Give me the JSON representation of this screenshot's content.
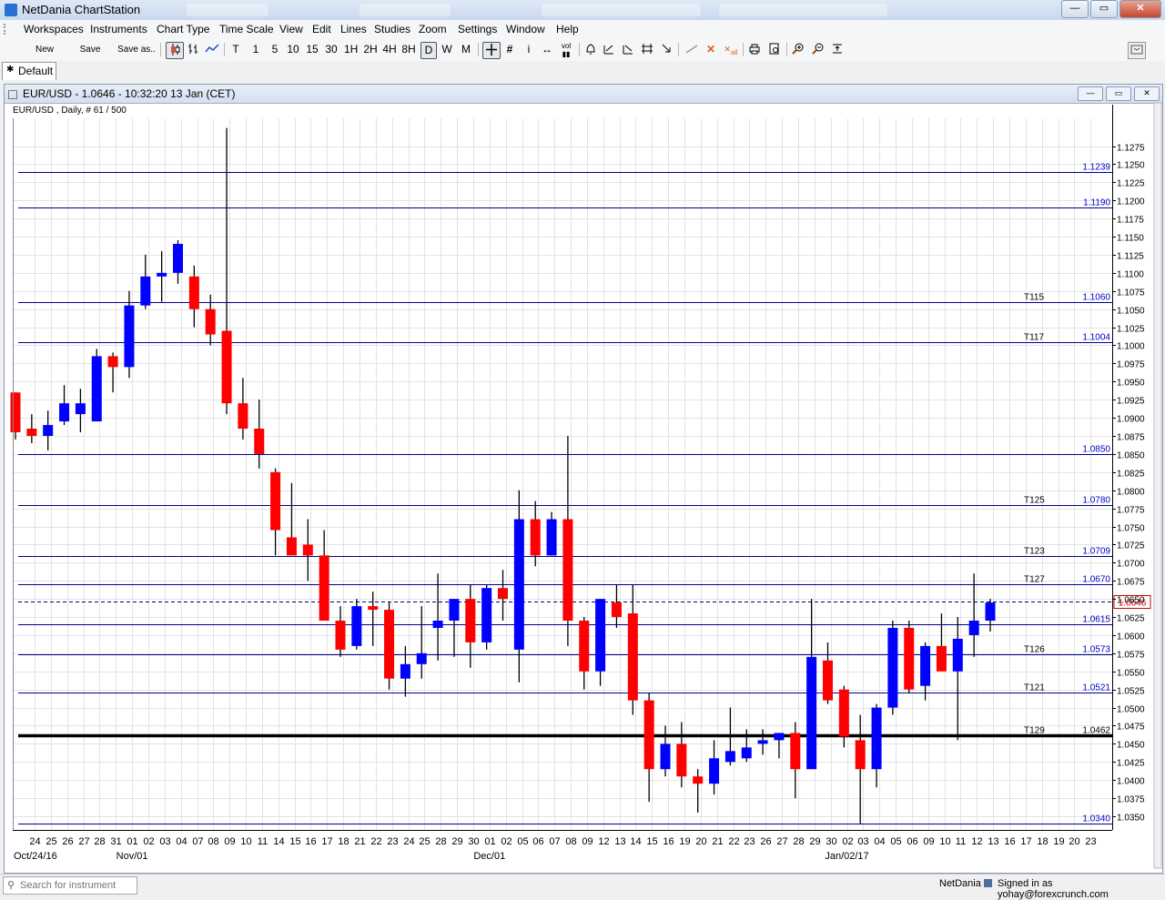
{
  "app": {
    "title": "NetDania ChartStation",
    "window_buttons": [
      "—",
      "▭",
      "✕"
    ]
  },
  "menu": [
    "Workspaces",
    "Instruments",
    "Chart Type",
    "Time Scale",
    "View",
    "Edit",
    "Lines",
    "Zoom",
    "Studies",
    "Zoom",
    "Settings",
    "Window",
    "Help"
  ],
  "toolbar": {
    "new": "New",
    "save": "Save",
    "save_as": "Save as..",
    "timescales": [
      "T",
      "1",
      "5",
      "10",
      "15",
      "30",
      "1H",
      "2H",
      "4H",
      "8H",
      "D",
      "W",
      "M"
    ],
    "active_timescale": "D",
    "icons": [
      "candle-icon",
      "bar-chart-icon",
      "line-chart-icon",
      "crosshair-icon",
      "grid-icon",
      "info-icon",
      "arrows-icon",
      "volume-icon",
      "alarm-icon",
      "trend-icons",
      "draw-line-icon",
      "delete-icon",
      "delete-all-icon",
      "print-icon",
      "preview-icon",
      "zoom-in-icon",
      "zoom-out-icon",
      "fit-icon"
    ]
  },
  "workspace_tab": "Default",
  "chart_window": {
    "title": "EUR/USD - 1.0646 - 10:32:20  13 Jan (CET)",
    "subtitle": "EUR/USD , Daily, # 61 / 500",
    "buttons": [
      "—",
      "▭",
      "✕"
    ]
  },
  "chart_data": {
    "type": "candlestick",
    "instrument": "EUR/USD",
    "ylim": [
      1.034,
      1.1275
    ],
    "y_ticks": [
      1.035,
      1.0375,
      1.04,
      1.0425,
      1.045,
      1.0475,
      1.05,
      1.0525,
      1.055,
      1.0575,
      1.06,
      1.0625,
      1.065,
      1.0675,
      1.07,
      1.0725,
      1.075,
      1.0775,
      1.08,
      1.0825,
      1.085,
      1.0875,
      1.09,
      1.0925,
      1.095,
      1.0975,
      1.1,
      1.1025,
      1.105,
      1.1075,
      1.11,
      1.1125,
      1.115,
      1.1175,
      1.12,
      1.1225,
      1.125,
      1.1275
    ],
    "x_labels": [
      "24",
      "25",
      "26",
      "27",
      "28",
      "31",
      "01",
      "02",
      "03",
      "04",
      "07",
      "08",
      "09",
      "10",
      "11",
      "14",
      "15",
      "16",
      "17",
      "18",
      "21",
      "22",
      "23",
      "24",
      "25",
      "28",
      "29",
      "30",
      "01",
      "02",
      "05",
      "06",
      "07",
      "08",
      "09",
      "12",
      "13",
      "14",
      "15",
      "16",
      "19",
      "20",
      "21",
      "22",
      "23",
      "26",
      "27",
      "28",
      "29",
      "30",
      "02",
      "03",
      "04",
      "05",
      "06",
      "09",
      "10",
      "11",
      "12",
      "13",
      "16",
      "17",
      "18",
      "19",
      "20",
      "23"
    ],
    "month_labels": [
      {
        "text": "Oct/24/16",
        "at_index": 0
      },
      {
        "text": "Nov/01",
        "at_index": 6
      },
      {
        "text": "Dec/01",
        "at_index": 28
      },
      {
        "text": "Jan/02/17",
        "at_index": 50
      }
    ],
    "candles": [
      {
        "o": 1.0935,
        "h": 1.0935,
        "l": 1.087,
        "c": 1.088
      },
      {
        "o": 1.0885,
        "h": 1.0905,
        "l": 1.0865,
        "c": 1.0875
      },
      {
        "o": 1.0875,
        "h": 1.091,
        "l": 1.0855,
        "c": 1.089
      },
      {
        "o": 1.0895,
        "h": 1.0945,
        "l": 1.089,
        "c": 1.092
      },
      {
        "o": 1.0905,
        "h": 1.094,
        "l": 1.088,
        "c": 1.092
      },
      {
        "o": 1.0895,
        "h": 1.0995,
        "l": 1.0895,
        "c": 1.0985
      },
      {
        "o": 1.0985,
        "h": 1.099,
        "l": 1.0935,
        "c": 1.097
      },
      {
        "o": 1.097,
        "h": 1.1075,
        "l": 1.0955,
        "c": 1.1055
      },
      {
        "o": 1.1055,
        "h": 1.1125,
        "l": 1.105,
        "c": 1.1095
      },
      {
        "o": 1.1095,
        "h": 1.113,
        "l": 1.106,
        "c": 1.11
      },
      {
        "o": 1.11,
        "h": 1.1145,
        "l": 1.1085,
        "c": 1.114
      },
      {
        "o": 1.1095,
        "h": 1.111,
        "l": 1.1025,
        "c": 1.105
      },
      {
        "o": 1.105,
        "h": 1.107,
        "l": 1.1,
        "c": 1.1015
      },
      {
        "o": 1.102,
        "h": 1.13,
        "l": 1.0905,
        "c": 1.092
      },
      {
        "o": 1.092,
        "h": 1.0955,
        "l": 1.087,
        "c": 1.0885
      },
      {
        "o": 1.0885,
        "h": 1.0925,
        "l": 1.083,
        "c": 1.085
      },
      {
        "o": 1.0825,
        "h": 1.083,
        "l": 1.071,
        "c": 1.0745
      },
      {
        "o": 1.0735,
        "h": 1.081,
        "l": 1.0715,
        "c": 1.071
      },
      {
        "o": 1.0725,
        "h": 1.076,
        "l": 1.0675,
        "c": 1.071
      },
      {
        "o": 1.071,
        "h": 1.0745,
        "l": 1.0635,
        "c": 1.062
      },
      {
        "o": 1.062,
        "h": 1.064,
        "l": 1.057,
        "c": 1.058
      },
      {
        "o": 1.0585,
        "h": 1.065,
        "l": 1.058,
        "c": 1.064
      },
      {
        "o": 1.064,
        "h": 1.066,
        "l": 1.0585,
        "c": 1.0635
      },
      {
        "o": 1.0635,
        "h": 1.0645,
        "l": 1.0525,
        "c": 1.054
      },
      {
        "o": 1.054,
        "h": 1.0585,
        "l": 1.0515,
        "c": 1.056
      },
      {
        "o": 1.056,
        "h": 1.064,
        "l": 1.054,
        "c": 1.0575
      },
      {
        "o": 1.061,
        "h": 1.0685,
        "l": 1.0565,
        "c": 1.062
      },
      {
        "o": 1.062,
        "h": 1.065,
        "l": 1.057,
        "c": 1.065
      },
      {
        "o": 1.065,
        "h": 1.067,
        "l": 1.0555,
        "c": 1.059
      },
      {
        "o": 1.059,
        "h": 1.067,
        "l": 1.058,
        "c": 1.0665
      },
      {
        "o": 1.0665,
        "h": 1.069,
        "l": 1.062,
        "c": 1.065
      },
      {
        "o": 1.058,
        "h": 1.08,
        "l": 1.0535,
        "c": 1.076
      },
      {
        "o": 1.076,
        "h": 1.0785,
        "l": 1.0695,
        "c": 1.071
      },
      {
        "o": 1.071,
        "h": 1.077,
        "l": 1.071,
        "c": 1.076
      },
      {
        "o": 1.076,
        "h": 1.0875,
        "l": 1.0585,
        "c": 1.062
      },
      {
        "o": 1.062,
        "h": 1.0625,
        "l": 1.0525,
        "c": 1.055
      },
      {
        "o": 1.055,
        "h": 1.065,
        "l": 1.053,
        "c": 1.065
      },
      {
        "o": 1.0645,
        "h": 1.067,
        "l": 1.061,
        "c": 1.0625
      },
      {
        "o": 1.063,
        "h": 1.067,
        "l": 1.049,
        "c": 1.051
      },
      {
        "o": 1.051,
        "h": 1.052,
        "l": 1.037,
        "c": 1.0415
      },
      {
        "o": 1.0415,
        "h": 1.0475,
        "l": 1.0405,
        "c": 1.045
      },
      {
        "o": 1.045,
        "h": 1.048,
        "l": 1.039,
        "c": 1.0405
      },
      {
        "o": 1.0405,
        "h": 1.0415,
        "l": 1.0355,
        "c": 1.0395
      },
      {
        "o": 1.0395,
        "h": 1.0455,
        "l": 1.038,
        "c": 1.043
      },
      {
        "o": 1.0425,
        "h": 1.05,
        "l": 1.042,
        "c": 1.044
      },
      {
        "o": 1.043,
        "h": 1.047,
        "l": 1.0425,
        "c": 1.0445
      },
      {
        "o": 1.045,
        "h": 1.047,
        "l": 1.0435,
        "c": 1.0455
      },
      {
        "o": 1.0455,
        "h": 1.0465,
        "l": 1.043,
        "c": 1.0465
      },
      {
        "o": 1.0465,
        "h": 1.048,
        "l": 1.0375,
        "c": 1.0415
      },
      {
        "o": 1.0415,
        "h": 1.065,
        "l": 1.0415,
        "c": 1.057
      },
      {
        "o": 1.0565,
        "h": 1.059,
        "l": 1.0505,
        "c": 1.051
      },
      {
        "o": 1.0525,
        "h": 1.053,
        "l": 1.0445,
        "c": 1.046
      },
      {
        "o": 1.0455,
        "h": 1.049,
        "l": 1.034,
        "c": 1.0415
      },
      {
        "o": 1.0415,
        "h": 1.0505,
        "l": 1.039,
        "c": 1.05
      },
      {
        "o": 1.05,
        "h": 1.062,
        "l": 1.049,
        "c": 1.061
      },
      {
        "o": 1.061,
        "h": 1.062,
        "l": 1.052,
        "c": 1.0525
      },
      {
        "o": 1.053,
        "h": 1.059,
        "l": 1.051,
        "c": 1.0585
      },
      {
        "o": 1.0585,
        "h": 1.063,
        "l": 1.0555,
        "c": 1.055
      },
      {
        "o": 1.055,
        "h": 1.0625,
        "l": 1.0455,
        "c": 1.0595
      },
      {
        "o": 1.06,
        "h": 1.0685,
        "l": 1.057,
        "c": 1.062
      },
      {
        "o": 1.062,
        "h": 1.065,
        "l": 1.0605,
        "c": 1.0645
      }
    ],
    "horizontal_lines": [
      {
        "value": 1.1239,
        "label": "1.1239",
        "tag": ""
      },
      {
        "value": 1.119,
        "label": "1.1190",
        "tag": ""
      },
      {
        "value": 1.106,
        "label": "1.1060",
        "tag": "T115"
      },
      {
        "value": 1.1004,
        "label": "1.1004",
        "tag": "T117"
      },
      {
        "value": 1.085,
        "label": "1.0850",
        "tag": ""
      },
      {
        "value": 1.078,
        "label": "1.0780",
        "tag": "T125"
      },
      {
        "value": 1.0709,
        "label": "1.0709",
        "tag": "T123"
      },
      {
        "value": 1.067,
        "label": "1.0670",
        "tag": "T127"
      },
      {
        "value": 1.0615,
        "label": "1.0615",
        "tag": ""
      },
      {
        "value": 1.0573,
        "label": "1.0573",
        "tag": "T126"
      },
      {
        "value": 1.0521,
        "label": "1.0521",
        "tag": "T121"
      },
      {
        "value": 1.0462,
        "label": "1.0462",
        "tag": "T129",
        "bold": true
      },
      {
        "value": 1.034,
        "label": "1.0340",
        "tag": ""
      }
    ],
    "current_price": {
      "value": 1.0646,
      "label": "1.0646"
    },
    "colors": {
      "up": "#0000ff",
      "down": "#ff0000",
      "line": "#00008b",
      "grid": "#e3e3e3",
      "current": "#d00000"
    }
  },
  "statusbar": {
    "search_placeholder": "Search for instrument",
    "brand": "NetDania",
    "signed_in": "Signed in as yohay@forexcrunch.com"
  }
}
